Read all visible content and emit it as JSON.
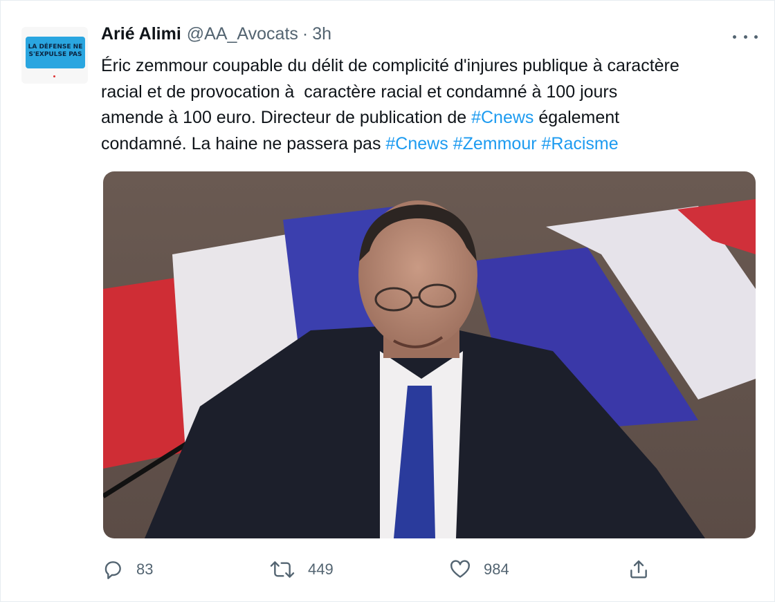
{
  "author": {
    "name": "Arié Alimi",
    "handle": "@AA_Avocats",
    "separator": "·",
    "time": "3h",
    "avatar_text": "LA DÉFENSE NE S'EXPULSE PAS"
  },
  "tweet": {
    "lines": [
      [
        {
          "t": "Éric zemmour coupable du délit de complicité d'injures publique à caractère",
          "tag": false
        }
      ],
      [
        {
          "t": "racial et de provocation à  caractère racial et condamné à 100 jours",
          "tag": false
        }
      ],
      [
        {
          "t": "amende à 100 euro. Directeur de publication de ",
          "tag": false
        },
        {
          "t": "#Cnews",
          "tag": true
        },
        {
          "t": " également",
          "tag": false
        }
      ],
      [
        {
          "t": "condamné. La haine ne passera pas ",
          "tag": false
        },
        {
          "t": "#Cnews",
          "tag": true
        },
        {
          "t": " ",
          "tag": false
        },
        {
          "t": "#Zemmour",
          "tag": true
        },
        {
          "t": " ",
          "tag": false
        },
        {
          "t": "#Racisme",
          "tag": true
        }
      ]
    ]
  },
  "actions": {
    "reply_count": "83",
    "retweet_count": "449",
    "like_count": "984"
  },
  "colors": {
    "link": "#1d9bf0",
    "muted": "#536471",
    "text": "#0f1419"
  },
  "icons": [
    "more-icon",
    "reply-icon",
    "retweet-icon",
    "like-icon",
    "share-icon"
  ]
}
